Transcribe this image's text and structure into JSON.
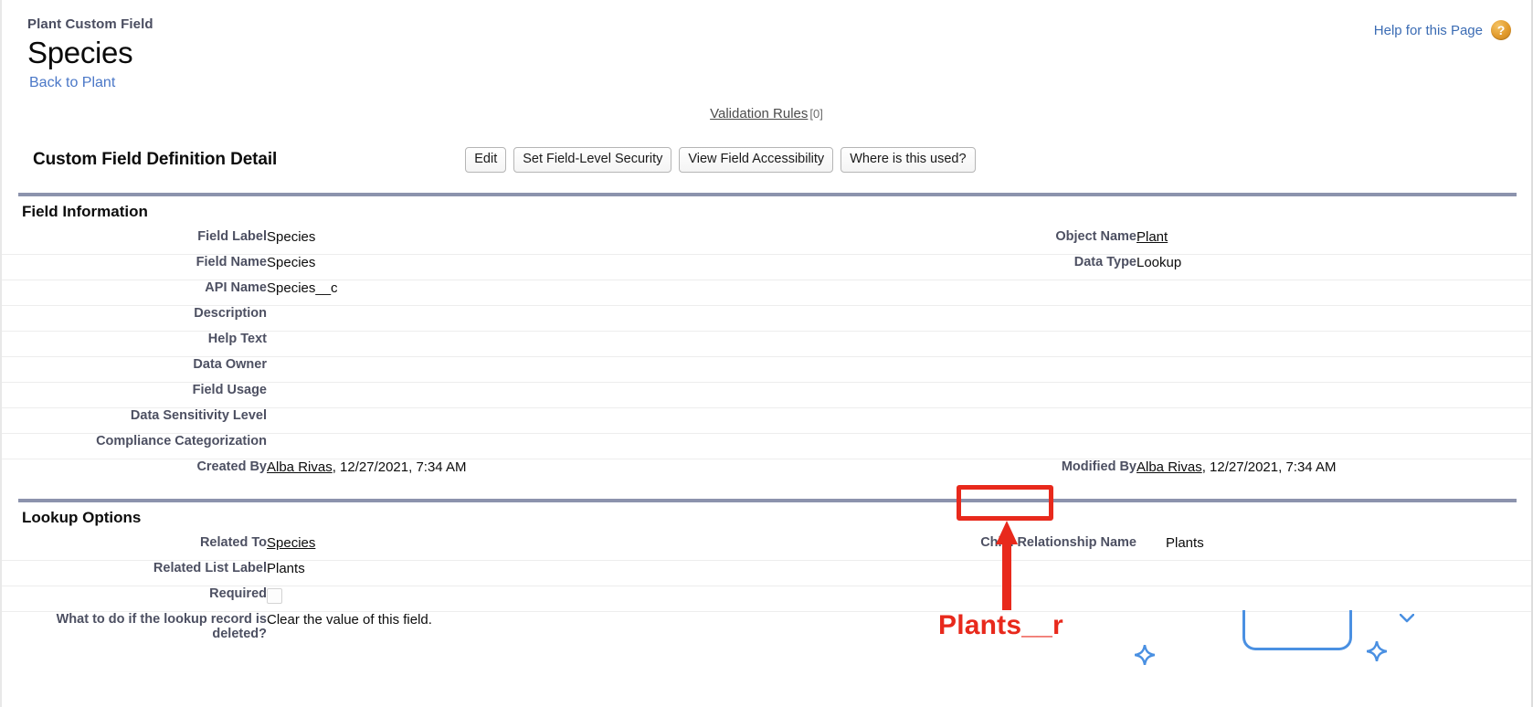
{
  "header": {
    "eyebrow": "Plant Custom Field",
    "title": "Species",
    "back_link": "Back to Plant",
    "help_link": "Help for this Page",
    "help_icon": "help-question-icon"
  },
  "shortcuts": {
    "validation_rules_label": "Validation Rules",
    "validation_rules_count": "[0]"
  },
  "action_bar": {
    "heading": "Custom Field Definition Detail",
    "buttons": [
      {
        "label": "Edit"
      },
      {
        "label": "Set Field-Level Security"
      },
      {
        "label": "View Field Accessibility"
      },
      {
        "label": "Where is this used?"
      }
    ]
  },
  "field_information": {
    "section_title": "Field Information",
    "rows": [
      {
        "label_left": "Field Label",
        "value_left": "Species",
        "label_right": "Object Name",
        "value_right": "Plant",
        "link_right": true
      },
      {
        "label_left": "Field Name",
        "value_left": "Species",
        "label_right": "Data Type",
        "value_right": "Lookup"
      },
      {
        "label_left": "API Name",
        "value_left": "Species__c",
        "label_right": "",
        "value_right": ""
      },
      {
        "label_left": "Description",
        "value_left": "",
        "label_right": "",
        "value_right": ""
      },
      {
        "label_left": "Help Text",
        "value_left": "",
        "label_right": "",
        "value_right": ""
      },
      {
        "label_left": "Data Owner",
        "value_left": "",
        "label_right": "",
        "value_right": ""
      },
      {
        "label_left": "Field Usage",
        "value_left": "",
        "label_right": "",
        "value_right": ""
      },
      {
        "label_left": "Data Sensitivity Level",
        "value_left": "",
        "label_right": "",
        "value_right": ""
      },
      {
        "label_left": "Compliance Categorization",
        "value_left": "",
        "label_right": "",
        "value_right": ""
      }
    ],
    "audit": {
      "created_label": "Created By",
      "created_user": "Alba Rivas",
      "created_timestamp": ", 12/27/2021, 7:34 AM",
      "modified_label": "Modified By",
      "modified_user": "Alba Rivas",
      "modified_timestamp": ", 12/27/2021, 7:34 AM"
    }
  },
  "lookup_options": {
    "section_title": "Lookup Options",
    "related_to_label": "Related To",
    "related_to_value": "Species",
    "child_relationship_label": "Child Relationship Name",
    "child_relationship_value": "Plants",
    "related_list_label": "Related List Label",
    "related_list_value": "Plants",
    "required_label": "Required",
    "required_checked": false,
    "delete_behavior_label": "What to do if the lookup record is deleted?",
    "delete_behavior_value": "Clear the value of this field."
  },
  "annotation": {
    "callout_text": "Plants__r",
    "color": "#e8291c"
  },
  "colors": {
    "section_rule": "#8c93ad",
    "link_blue": "#3b6cb4",
    "accent_blue": "#4a90e2",
    "label_gray": "#4d5062"
  }
}
